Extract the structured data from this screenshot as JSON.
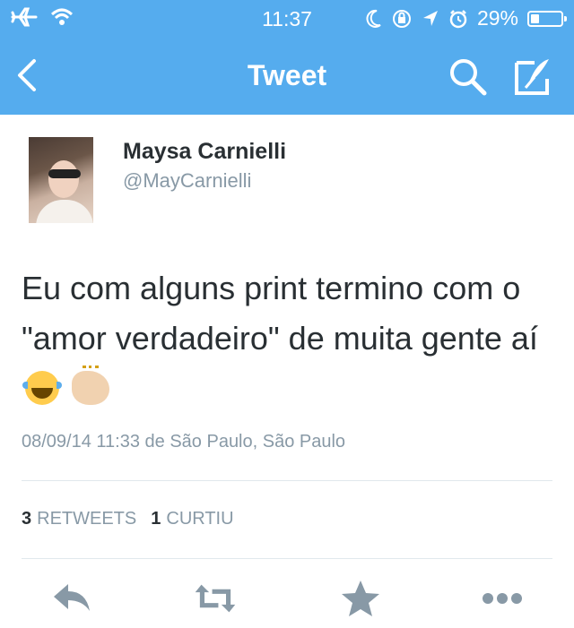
{
  "status_bar": {
    "time": "11:37",
    "battery": "29%",
    "battery_level": 0.29
  },
  "nav": {
    "title": "Tweet",
    "back_icon": "chevron-left-icon",
    "search_icon": "search-icon",
    "compose_icon": "compose-tweet-icon"
  },
  "tweet": {
    "user_name": "Maysa Carnielli",
    "user_handle": "@MayCarnielli",
    "text": "Eu com alguns print termino com o \"amor verdadeiro\" de muita gente aí",
    "emojis": [
      "face-with-tears-of-joy",
      "clapping-hands"
    ],
    "timestamp": "08/09/14 11:33 de São Paulo, São Paulo",
    "retweets_count": "3",
    "retweets_label": "RETWEETS",
    "likes_count": "1",
    "likes_label": "CURTIU"
  },
  "actions": [
    "reply-icon",
    "retweet-icon",
    "favorite-icon",
    "more-icon"
  ],
  "colors": {
    "brand": "#55acee",
    "text": "#292f33",
    "secondary": "#8899a6",
    "divider": "#e1e8ed",
    "action_icon": "#8899a6"
  }
}
